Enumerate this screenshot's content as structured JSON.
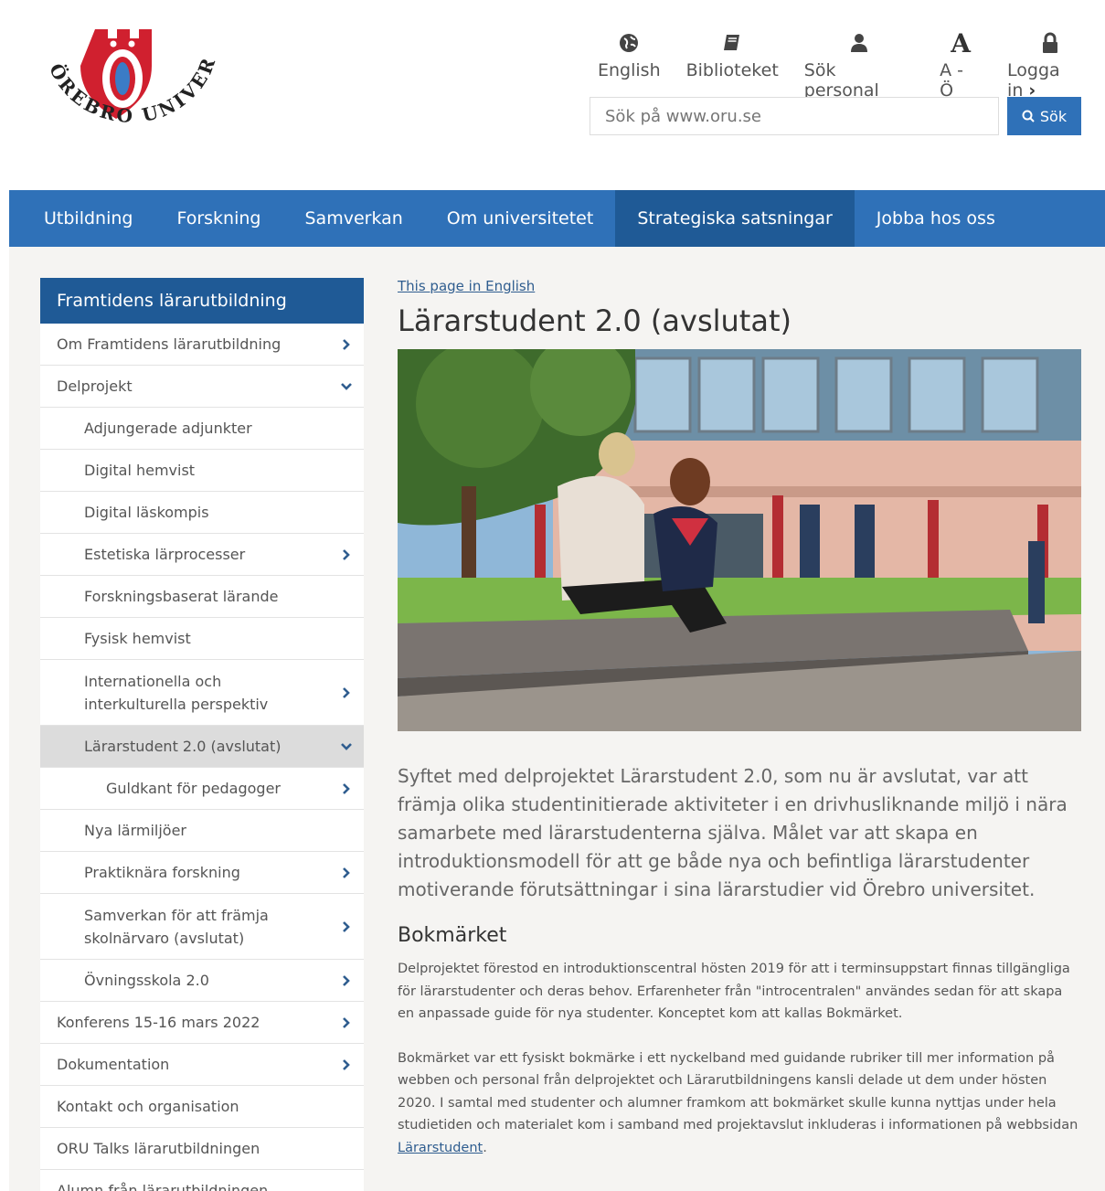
{
  "header": {
    "logo_text": "ÖREBRO UNIVERSITET",
    "utility": [
      {
        "label": "English",
        "icon": "globe-icon"
      },
      {
        "label": "Biblioteket",
        "icon": "book-icon"
      },
      {
        "label": "Sök personal",
        "icon": "person-icon"
      },
      {
        "label": "A - Ö",
        "icon": "letter-a-icon"
      },
      {
        "label": "Logga in",
        "icon": "lock-icon"
      }
    ],
    "search_placeholder": "Sök på www.oru.se",
    "search_button": "Sök"
  },
  "mainnav": {
    "items": [
      {
        "label": "Utbildning"
      },
      {
        "label": "Forskning"
      },
      {
        "label": "Samverkan"
      },
      {
        "label": "Om universitetet"
      },
      {
        "label": "Strategiska satsningar",
        "active": true
      },
      {
        "label": "Jobba hos oss"
      }
    ]
  },
  "sidebar": {
    "title": "Framtidens lärarutbildning",
    "items": [
      {
        "label": "Om Framtidens lärarutbildning",
        "level": 0,
        "arrow": "right"
      },
      {
        "label": "Delprojekt",
        "level": 0,
        "arrow": "down"
      },
      {
        "label": "Adjungerade adjunkter",
        "level": 1
      },
      {
        "label": "Digital hemvist",
        "level": 1
      },
      {
        "label": "Digital läskompis",
        "level": 1
      },
      {
        "label": "Estetiska lärprocesser",
        "level": 1,
        "arrow": "right"
      },
      {
        "label": "Forskningsbaserat lärande",
        "level": 1
      },
      {
        "label": "Fysisk hemvist",
        "level": 1
      },
      {
        "label": "Internationella och interkulturella perspektiv",
        "level": 1,
        "arrow": "right"
      },
      {
        "label": "Lärarstudent 2.0 (avslutat)",
        "level": 1,
        "arrow": "down",
        "active": true
      },
      {
        "label": "Guldkant för pedagoger",
        "level": 2,
        "arrow": "right"
      },
      {
        "label": "Nya lärmiljöer",
        "level": 1
      },
      {
        "label": "Praktiknära forskning",
        "level": 1,
        "arrow": "right"
      },
      {
        "label": "Samverkan för att främja skolnärvaro (avslutat)",
        "level": 1,
        "arrow": "right"
      },
      {
        "label": "Övningsskola 2.0",
        "level": 1,
        "arrow": "right"
      },
      {
        "label": "Konferens 15-16 mars 2022",
        "level": 0,
        "arrow": "right"
      },
      {
        "label": "Dokumentation",
        "level": 0,
        "arrow": "right"
      },
      {
        "label": "Kontakt och organisation",
        "level": 0
      },
      {
        "label": "ORU Talks lärarutbildningen",
        "level": 0
      },
      {
        "label": "Alumn från lärarutbildningen",
        "level": 0
      }
    ]
  },
  "article": {
    "lang_link": "This page in English",
    "title": "Lärarstudent 2.0 (avslutat)",
    "lead": "Syftet med delprojektet Lärarstudent 2.0, som nu är avslutat, var att främja olika studentinitierade aktiviteter i en drivhusliknande miljö i nära samarbete med lärarstudenterna själva. Målet var att skapa en introduktionsmodell för att ge både nya och befintliga lärarstudenter motiverande förutsättningar i sina lärarstudier vid Örebro universitet.",
    "heading": "Bokmärket",
    "para1": "Delprojektet förestod en introduktionscentral hösten 2019 för att i terminsuppstart finnas tillgängliga för lärarstudenter och deras behov. Erfarenheter från \"introcentralen\" användes sedan för att skapa en anpassade guide för nya studenter. Konceptet kom att kallas Bokmärket.",
    "para2_text": "Bokmärket var ett fysiskt bokmärke i ett nyckelband med guidande rubriker till mer information på webben och personal från delprojektet och Lärarutbildningens kansli delade ut dem under hösten 2020. I samtal med studenter och alumner framkom att bokmärket skulle kunna nyttjas under hela studietiden och materialet kom i samband med projektavslut inkluderas i informationen på webbsidan ",
    "para2_link": "Lärarstudent",
    "para2_end": "."
  },
  "colors": {
    "brand_blue": "#2f71b8",
    "dark_blue": "#1f5a96",
    "logo_red": "#d0202f"
  }
}
